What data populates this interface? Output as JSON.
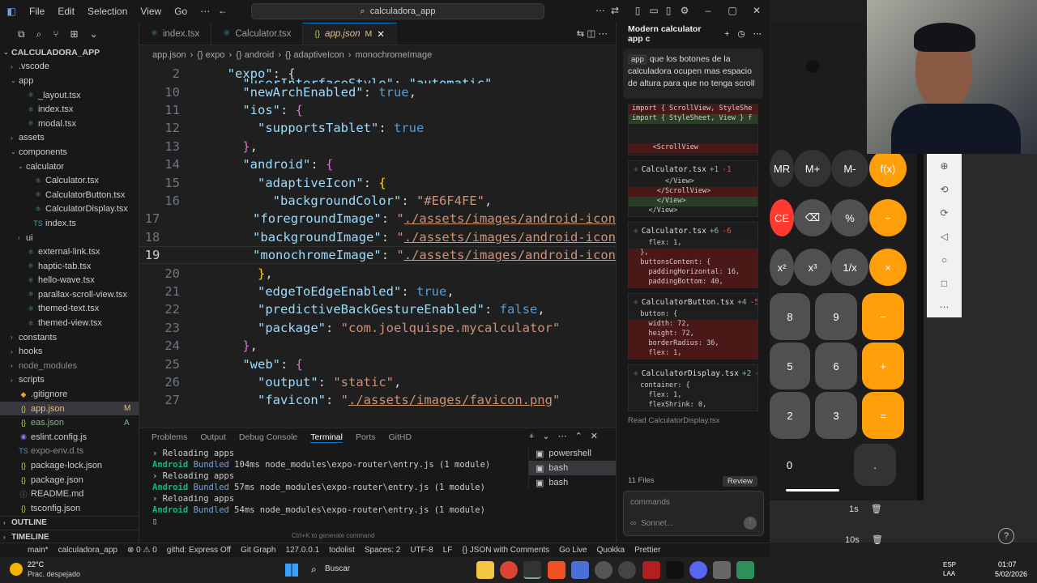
{
  "window": {
    "menu": [
      "File",
      "Edit",
      "Selection",
      "View",
      "Go"
    ],
    "search_text": "calculadora_app"
  },
  "explorer": {
    "rows": [
      {
        "name": "CALCULADORA_APP",
        "type": "root",
        "chev": "⌄",
        "ico": "",
        "indent": 0
      },
      {
        "name": ".vscode",
        "type": "folder",
        "chev": "›",
        "ico": "",
        "indent": 1
      },
      {
        "name": "app",
        "type": "folder",
        "chev": "⌄",
        "ico": "",
        "indent": 1
      },
      {
        "name": "_layout.tsx",
        "type": "file",
        "ico": "⚛",
        "color": "#519aba",
        "indent": 2
      },
      {
        "name": "index.tsx",
        "type": "file",
        "ico": "⚛",
        "color": "#519aba",
        "indent": 2
      },
      {
        "name": "modal.tsx",
        "type": "file",
        "ico": "⚛",
        "color": "#519aba",
        "indent": 2
      },
      {
        "name": "assets",
        "type": "folder",
        "chev": "›",
        "ico": "",
        "indent": 1
      },
      {
        "name": "components",
        "type": "folder",
        "chev": "⌄",
        "ico": "",
        "indent": 1
      },
      {
        "name": "calculator",
        "type": "folder",
        "chev": "⌄",
        "ico": "",
        "indent": 2
      },
      {
        "name": "Calculator.tsx",
        "type": "file",
        "ico": "⚛",
        "color": "#519aba",
        "indent": 3
      },
      {
        "name": "CalculatorButton.tsx",
        "type": "file",
        "ico": "⚛",
        "color": "#519aba",
        "indent": 3
      },
      {
        "name": "CalculatorDisplay.tsx",
        "type": "file",
        "ico": "⚛",
        "color": "#519aba",
        "indent": 3
      },
      {
        "name": "index.ts",
        "type": "file",
        "ico": "TS",
        "color": "#519aba",
        "indent": 3
      },
      {
        "name": "ui",
        "type": "folder",
        "chev": "›",
        "ico": "",
        "indent": 2
      },
      {
        "name": "external-link.tsx",
        "type": "file",
        "ico": "⚛",
        "color": "#519aba",
        "indent": 2
      },
      {
        "name": "haptic-tab.tsx",
        "type": "file",
        "ico": "⚛",
        "color": "#519aba",
        "indent": 2
      },
      {
        "name": "hello-wave.tsx",
        "type": "file",
        "ico": "⚛",
        "color": "#519aba",
        "indent": 2
      },
      {
        "name": "parallax-scroll-view.tsx",
        "type": "file",
        "ico": "⚛",
        "color": "#519aba",
        "indent": 2
      },
      {
        "name": "themed-text.tsx",
        "type": "file",
        "ico": "⚛",
        "color": "#519aba",
        "indent": 2
      },
      {
        "name": "themed-view.tsx",
        "type": "file",
        "ico": "⚛",
        "color": "#519aba",
        "indent": 2
      },
      {
        "name": "constants",
        "type": "folder",
        "chev": "›",
        "ico": "",
        "indent": 1
      },
      {
        "name": "hooks",
        "type": "folder",
        "chev": "›",
        "ico": "",
        "indent": 1
      },
      {
        "name": "node_modules",
        "type": "folder",
        "chev": "›",
        "ico": "",
        "indent": 1,
        "dim": true
      },
      {
        "name": "scripts",
        "type": "folder",
        "chev": "›",
        "ico": "",
        "indent": 1
      },
      {
        "name": ".gitignore",
        "type": "file",
        "ico": "◆",
        "color": "#e8a33d",
        "indent": 1
      },
      {
        "name": "app.json",
        "type": "file",
        "ico": "{}",
        "color": "#cbcb41",
        "indent": 1,
        "badge": "M",
        "selected": true
      },
      {
        "name": "eas.json",
        "type": "file",
        "ico": "{}",
        "color": "#cbcb41",
        "indent": 1,
        "badge": "A"
      },
      {
        "name": "eslint.config.js",
        "type": "file",
        "ico": "◉",
        "color": "#8080f2",
        "indent": 1
      },
      {
        "name": "expo-env.d.ts",
        "type": "file",
        "ico": "TS",
        "color": "#519aba",
        "indent": 1,
        "dim": true
      },
      {
        "name": "package-lock.json",
        "type": "file",
        "ico": "{}",
        "color": "#cbcb41",
        "indent": 1
      },
      {
        "name": "package.json",
        "type": "file",
        "ico": "{}",
        "color": "#cbcb41",
        "indent": 1
      },
      {
        "name": "README.md",
        "type": "file",
        "ico": "ⓘ",
        "color": "#519aba",
        "indent": 1
      },
      {
        "name": "tsconfig.json",
        "type": "file",
        "ico": "{}",
        "color": "#cbcb41",
        "indent": 1
      },
      {
        "name": "OUTLINE",
        "type": "section",
        "chev": "›",
        "indent": 0
      },
      {
        "name": "TIMELINE",
        "type": "section",
        "chev": "›",
        "indent": 0
      }
    ]
  },
  "editor": {
    "tabs": [
      {
        "label": "index.tsx",
        "ico": "⚛"
      },
      {
        "label": "Calculator.tsx",
        "ico": "⚛"
      },
      {
        "label": "app.json",
        "ico": "{}",
        "mod": "M",
        "active": true
      }
    ],
    "breadcrumb": [
      "app.json",
      "{} expo",
      "{} android",
      "{} adaptiveIcon",
      "monochromeImage"
    ],
    "lines": [
      {
        "n": "2",
        "html": "  <span class='k'>\"expo\"</span><span class='p'>: {</span>"
      },
      {
        "n": "10",
        "html": "    <span class='k'>\"newArchEnabled\"</span><span class='p'>: </span><span class='b'>true</span><span class='p'>,</span>"
      },
      {
        "n": "11",
        "html": "    <span class='k'>\"ios\"</span><span class='p'>: </span><span class='m'>{</span>"
      },
      {
        "n": "12",
        "html": "      <span class='k'>\"supportsTablet\"</span><span class='p'>: </span><span class='b'>true</span>"
      },
      {
        "n": "13",
        "html": "    <span class='m'>}</span><span class='p'>,</span>"
      },
      {
        "n": "14",
        "html": "    <span class='k'>\"android\"</span><span class='p'>: </span><span class='m'>{</span>"
      },
      {
        "n": "15",
        "html": "      <span class='k'>\"adaptiveIcon\"</span><span class='p'>: </span><span class='y'>{</span>"
      },
      {
        "n": "16",
        "html": "        <span class='k'>\"backgroundColor\"</span><span class='p'>: </span><span class='s'>\"#E6F4FE\"</span><span class='p'>,</span>"
      },
      {
        "n": "17",
        "html": "        <span class='k'>\"foregroundImage\"</span><span class='p'>: </span><span class='s'>\"<span class='link'>./assets/images/android-icon</span></span>"
      },
      {
        "n": "18",
        "html": "        <span class='k'>\"backgroundImage\"</span><span class='p'>: </span><span class='s'>\"<span class='link'>./assets/images/android-icon</span></span>"
      },
      {
        "n": "19",
        "html": "        <span class='k'>\"monochromeImage\"</span><span class='p'>: </span><span class='s'>\"<span class='link'>./assets/images/android-icon</span></span>",
        "cur": true
      },
      {
        "n": "20",
        "html": "      <span class='y'>}</span><span class='p'>,</span>"
      },
      {
        "n": "21",
        "html": "      <span class='k'>\"edgeToEdgeEnabled\"</span><span class='p'>: </span><span class='b'>true</span><span class='p'>,</span>"
      },
      {
        "n": "22",
        "html": "      <span class='k'>\"predictiveBackGestureEnabled\"</span><span class='p'>: </span><span class='b'>false</span><span class='p'>,</span>"
      },
      {
        "n": "23",
        "html": "      <span class='k'>\"package\"</span><span class='p'>: </span><span class='s'>\"com.joelquispe.mycalculator\"</span>"
      },
      {
        "n": "24",
        "html": "    <span class='m'>}</span><span class='p'>,</span>"
      },
      {
        "n": "25",
        "html": "    <span class='k'>\"web\"</span><span class='p'>: </span><span class='m'>{</span>"
      },
      {
        "n": "26",
        "html": "      <span class='k'>\"output\"</span><span class='p'>: </span><span class='s'>\"static\"</span><span class='p'>,</span>"
      },
      {
        "n": "27",
        "html": "      <span class='k'>\"favicon\"</span><span class='p'>: </span><span class='s'>\"<span class='link'>./assets/images/favicon.png</span>\"</span>"
      }
    ],
    "sticky": "    \"userInterfaceStyle\": \"automatic\","
  },
  "panel": {
    "tabs": [
      "Problems",
      "Output",
      "Debug Console",
      "Terminal",
      "Ports",
      "GitHD"
    ],
    "active": "Terminal",
    "term": [
      {
        "a": "› Reloading apps"
      },
      {
        "ok": "Android",
        "b": " Bundled ",
        "c": "104ms node_modules\\expo-router\\entry.js (1 module)"
      },
      {
        "a": "› Reloading apps"
      },
      {
        "ok": "Android",
        "b": " Bundled ",
        "c": "57ms node_modules\\expo-router\\entry.js (1 module)"
      },
      {
        "a": "› Reloading apps"
      },
      {
        "ok": "Android",
        "b": " Bundled ",
        "c": "54ms node_modules\\expo-router\\entry.js (1 module)"
      }
    ],
    "terminals": [
      "powershell",
      "bash",
      "bash"
    ],
    "hint": "Ctrl+K to generate command"
  },
  "chat": {
    "title": "Modern calculator app c",
    "message_tag": "app",
    "message": "que los botones de la calculadora ocupen mas espacio de altura para que no tenga scroll",
    "diff0": [
      {
        "t": "del",
        "s": "import { ScrollView, StyleShe"
      },
      {
        "t": "add",
        "s": "import { StyleSheet, View } f"
      },
      {
        "t": "n",
        "s": ""
      },
      {
        "t": "n",
        "s": ""
      },
      {
        "t": "del",
        "s": "     <ScrollView"
      }
    ],
    "diffs": [
      {
        "file": "Calculator.tsx",
        "plus": "+1",
        "minus": "-1",
        "lines": [
          {
            "t": "n",
            "s": "        </View>"
          },
          {
            "t": "del",
            "s": "      </ScrollView>"
          },
          {
            "t": "add",
            "s": "      </View>"
          },
          {
            "t": "n",
            "s": "    </View>"
          }
        ]
      },
      {
        "file": "Calculator.tsx",
        "plus": "+6",
        "minus": "-6",
        "lines": [
          {
            "t": "n",
            "s": "    flex: 1,"
          },
          {
            "t": "del",
            "s": "  },"
          },
          {
            "t": "del",
            "s": "  buttonsContent: {"
          },
          {
            "t": "del",
            "s": "    paddingHorizontal: 16,"
          },
          {
            "t": "del",
            "s": "    paddingBottom: 40,"
          }
        ]
      },
      {
        "file": "CalculatorButton.tsx",
        "plus": "+4",
        "minus": "-5",
        "lines": [
          {
            "t": "n",
            "s": "  button: {"
          },
          {
            "t": "del",
            "s": "    width: 72,"
          },
          {
            "t": "del",
            "s": "    height: 72,"
          },
          {
            "t": "del",
            "s": "    borderRadius: 36,"
          },
          {
            "t": "del",
            "s": "    flex: 1,"
          }
        ]
      },
      {
        "file": "CalculatorDisplay.tsx",
        "plus": "+2",
        "minus": "-2",
        "lines": [
          {
            "t": "n",
            "s": "  container: {"
          },
          {
            "t": "n",
            "s": "    flex: 1,"
          },
          {
            "t": "n",
            "s": "    flexShrink: 0,"
          }
        ]
      }
    ],
    "read_label": "Read",
    "read_file": "CalculatorDisplay.tsx",
    "files_count": "11 Files",
    "review": "Review",
    "input_placeholder": "commands",
    "model": "Sonnet..."
  },
  "phone": {
    "rows": [
      [
        "MR",
        "M+",
        "M-",
        "f(x)"
      ],
      [
        "CE",
        "⌫",
        "%",
        "÷"
      ],
      [
        "x²",
        "x³",
        "1/x",
        "×"
      ],
      [
        "8",
        "9",
        "−"
      ],
      [
        "5",
        "6",
        "+"
      ],
      [
        "2",
        "3",
        "="
      ],
      [
        "0",
        "."
      ]
    ],
    "timers": [
      "1s",
      "10s"
    ]
  },
  "statusbar": [
    "main*",
    "calculadora_app",
    "⊗ 0 ⚠ 0",
    "githd: Express Off",
    "Git Graph",
    "127.0.0.1",
    "todolist",
    "Spaces: 2",
    "UTF-8",
    "LF",
    "{} JSON with Comments",
    "Go Live",
    "Quokka",
    "Prettier"
  ],
  "taskbar": {
    "weather_temp": "22°C",
    "weather_desc": "Prac. despejado",
    "search": "Buscar",
    "lang": "ESP",
    "lang2": "LAA",
    "time": "01:07",
    "date": "5/02/2026"
  }
}
